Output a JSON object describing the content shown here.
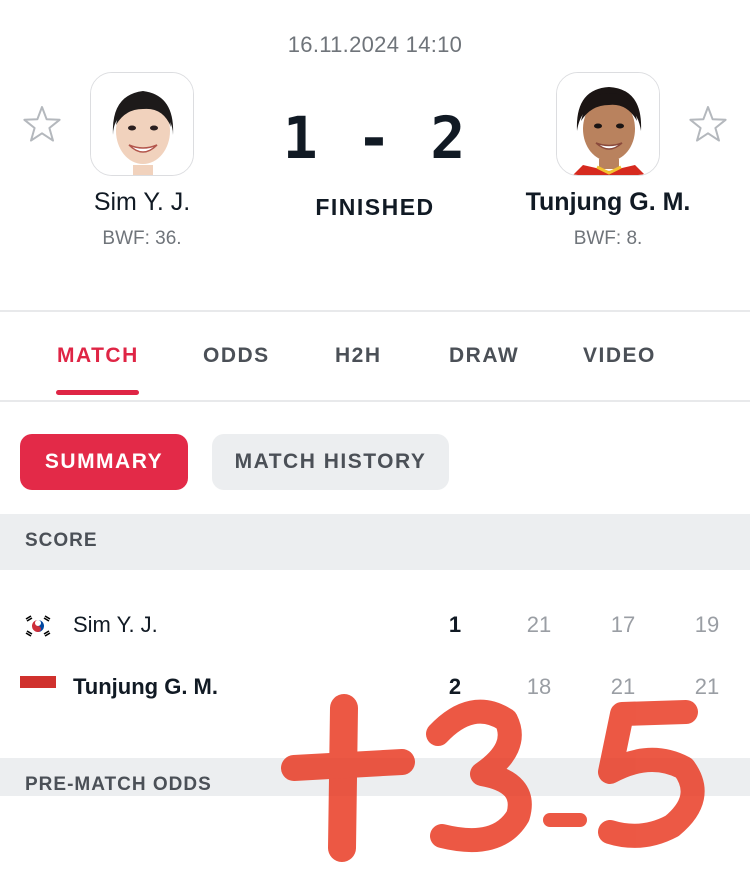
{
  "match": {
    "datetime": "16.11.2024 14:10",
    "score": "1 - 2",
    "status": "FINISHED"
  },
  "home": {
    "name": "Sim Y. J.",
    "rank": "BWF: 36.",
    "avatar_icon": "player-photo-icon",
    "flag_icon": "south-korea-flag-icon"
  },
  "away": {
    "name": "Tunjung G. M.",
    "rank": "BWF: 8.",
    "avatar_icon": "player-photo-icon",
    "flag_icon": "indonesia-flag-icon"
  },
  "tabs": [
    {
      "label": "MATCH",
      "active": true
    },
    {
      "label": "ODDS",
      "active": false
    },
    {
      "label": "H2H",
      "active": false
    },
    {
      "label": "DRAW",
      "active": false
    },
    {
      "label": "VIDEO",
      "active": false
    }
  ],
  "subtabs": [
    {
      "label": "SUMMARY",
      "active": true
    },
    {
      "label": "MATCH HISTORY",
      "active": false
    }
  ],
  "sections": {
    "score": "SCORE",
    "prematch_odds": "PRE-MATCH ODDS"
  },
  "score_table": [
    {
      "name": "Sim Y. J.",
      "total": "1",
      "sets": [
        "21",
        "17",
        "19"
      ]
    },
    {
      "name": "Tunjung G. M.",
      "total": "2",
      "sets": [
        "18",
        "21",
        "21"
      ]
    }
  ],
  "annotation": {
    "text": "+3.5",
    "color": "#e8341c"
  },
  "colors": {
    "accent": "#df2545",
    "text": "#111a24",
    "muted": "#6f747a"
  }
}
